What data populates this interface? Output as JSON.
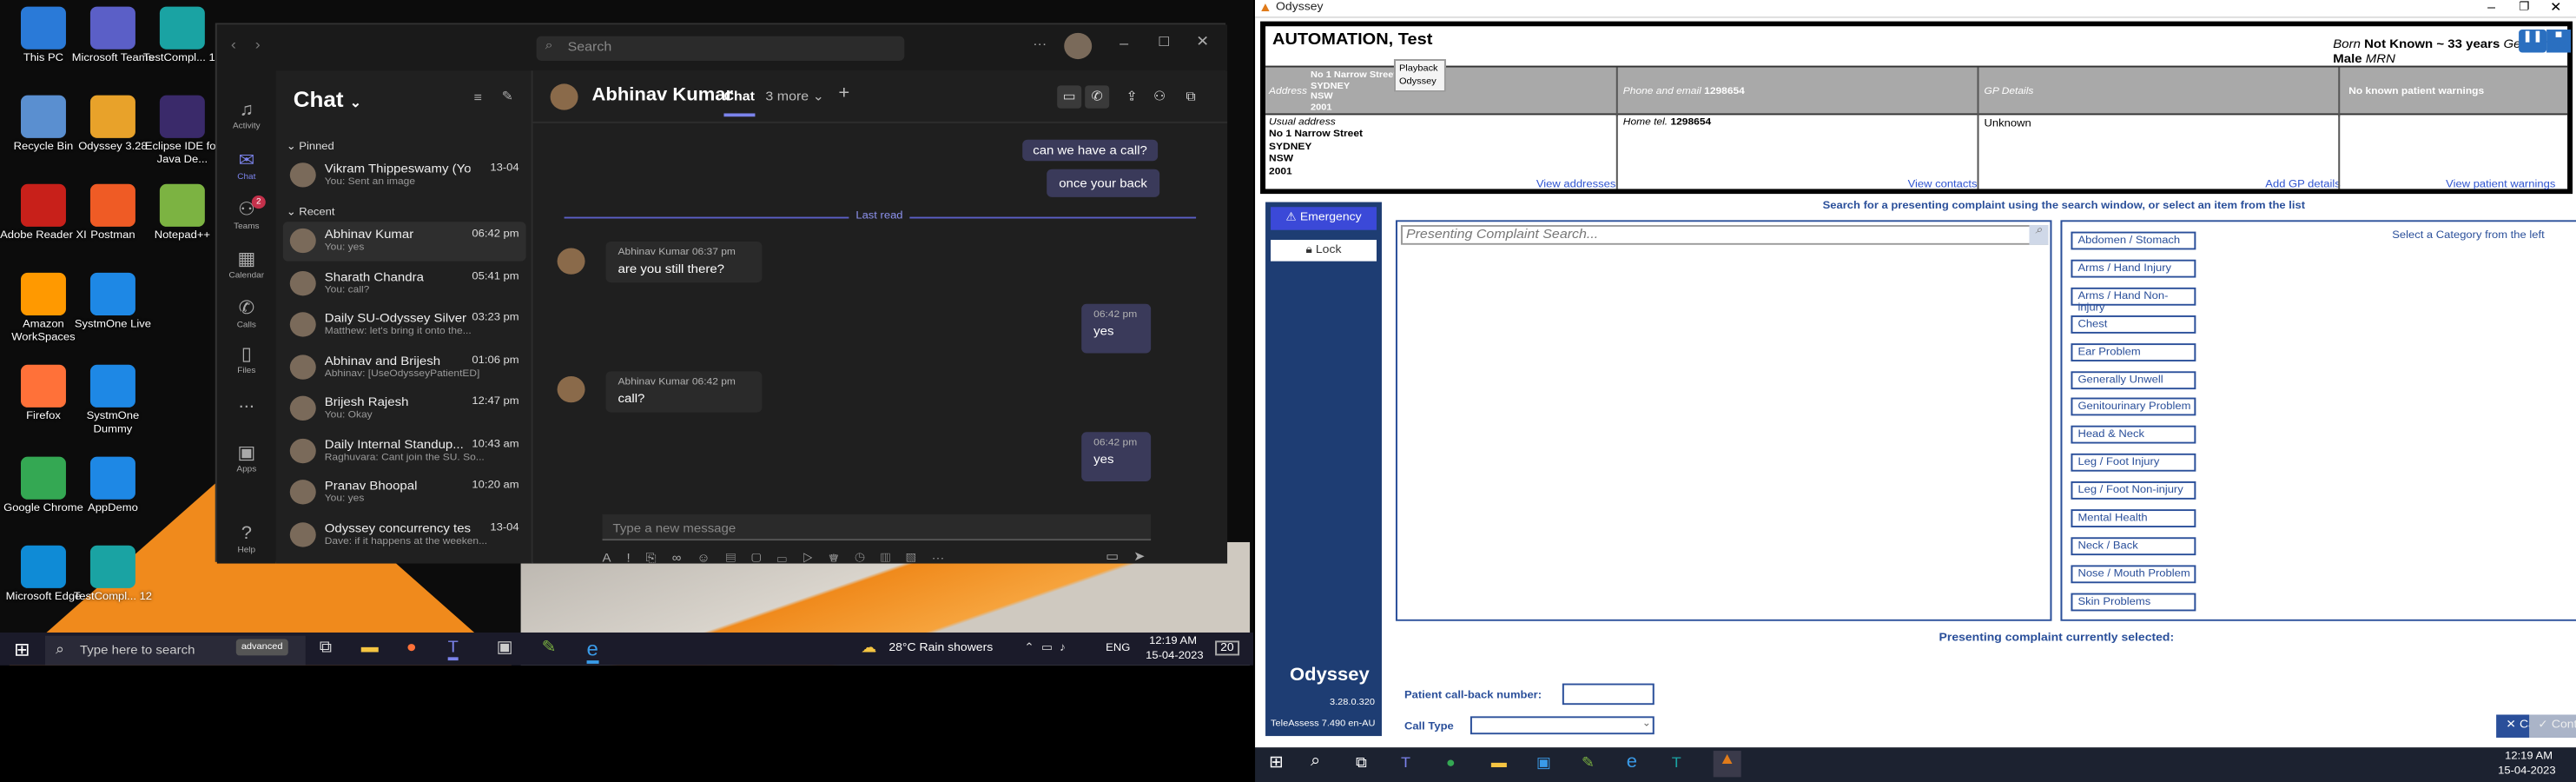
{
  "desktop": {
    "icons": [
      {
        "label": "This PC",
        "icon": "computer-icon",
        "color": "#2a7ad8"
      },
      {
        "label": "Microsoft Teams",
        "icon": "teams-icon",
        "color": "#5b5fc7"
      },
      {
        "label": "TestCompl... 14",
        "icon": "testcomplete-icon",
        "color": "#1aa3a3"
      },
      {
        "label": "Recycle Bin",
        "icon": "recycle-bin-icon",
        "color": "#5a8fd0"
      },
      {
        "label": "Odyssey 3.28",
        "icon": "odyssey-icon",
        "color": "#e8a22a"
      },
      {
        "label": "Eclipse IDE for Java De...",
        "icon": "eclipse-icon",
        "color": "#3a2a6a"
      },
      {
        "label": "Adobe Reader XI",
        "icon": "adobe-reader-icon",
        "color": "#c8201a"
      },
      {
        "label": "Postman",
        "icon": "postman-icon",
        "color": "#ef5b25"
      },
      {
        "label": "Notepad++",
        "icon": "notepad-plus-icon",
        "color": "#7cb342"
      },
      {
        "label": "Amazon WorkSpaces",
        "icon": "workspaces-icon",
        "color": "#ff9900"
      },
      {
        "label": "SystmOne Live",
        "icon": "systmone-icon",
        "color": "#1e88e5"
      },
      {
        "label": "Firefox",
        "icon": "firefox-icon",
        "color": "#ff7139"
      },
      {
        "label": "SystmOne Dummy",
        "icon": "systmone-icon",
        "color": "#1e88e5"
      },
      {
        "label": "Google Chrome",
        "icon": "chrome-icon",
        "color": "#34a853"
      },
      {
        "label": "AppDemo",
        "icon": "systmone-icon",
        "color": "#1e88e5"
      },
      {
        "label": "Microsoft Edge",
        "icon": "edge-icon",
        "color": "#0f8bd6"
      },
      {
        "label": "TestCompl... 12",
        "icon": "testcomplete-icon",
        "color": "#1aa3a3"
      }
    ]
  },
  "teams": {
    "search_placeholder": "Search",
    "rail": [
      "Activity",
      "Chat",
      "Teams",
      "Calendar",
      "Calls",
      "Files",
      "...",
      "Apps",
      "Help"
    ],
    "teams_badge": "2",
    "list_title": "Chat",
    "pinned_label": "Pinned",
    "recent_label": "Recent",
    "pinned": [
      {
        "name": "Vikram Thippeswamy (Yo...",
        "time": "13-04",
        "preview": "You: Sent an image"
      }
    ],
    "recent": [
      {
        "name": "Abhinav Kumar",
        "time": "06:42 pm",
        "preview": "You: yes",
        "selected": true
      },
      {
        "name": "Sharath Chandra",
        "time": "05:41 pm",
        "preview": "You: call?"
      },
      {
        "name": "Daily SU-Odyssey Silver",
        "time": "03:23 pm",
        "preview": "Matthew: let's bring it onto the..."
      },
      {
        "name": "Abhinav and Brijesh",
        "time": "01:06 pm",
        "preview": "Abhinav: [UseOdysseyPatientED]"
      },
      {
        "name": "Brijesh Rajesh",
        "time": "12:47 pm",
        "preview": "You: Okay"
      },
      {
        "name": "Daily Internal Standup...",
        "time": "10:43 am",
        "preview": "Raghuvara: Cant join the SU. So..."
      },
      {
        "name": "Pranav Bhoopal",
        "time": "10:20 am",
        "preview": "You: yes"
      },
      {
        "name": "Odyssey concurrency tes...",
        "time": "13-04",
        "preview": "Dave: if it happens at the weeken..."
      }
    ],
    "conversation": {
      "contact": "Abhinav Kumar",
      "tab_chat": "Chat",
      "tab_more": "3 more",
      "plus": "+",
      "msg_top1": "can we have a call?",
      "msg_top2": "once your back",
      "last_read": "Last read",
      "messages": [
        {
          "sender": "Abhinav Kumar",
          "time": "06:37 pm",
          "text": "are you still there?"
        },
        {
          "time": "06:42 pm",
          "text": "yes"
        },
        {
          "sender": "Abhinav Kumar",
          "time": "06:42 pm",
          "text": "call?"
        },
        {
          "time": "06:42 pm",
          "text": "yes"
        }
      ],
      "compose_placeholder": "Type a new message"
    }
  },
  "taskbar_left": {
    "search_placeholder": "Type here to search",
    "search_tag": "advanced",
    "weather": "28°C  Rain showers",
    "lang": "ENG",
    "time": "12:19 AM",
    "date": "15-04-2023",
    "badge": "20"
  },
  "odyssey": {
    "window_title": "Odyssey",
    "patient_name": "AUTOMATION, Test",
    "born_label": "Born",
    "born_value": "Not Known ~ 33 years",
    "gender_label": "Gender",
    "gender_value": "Male",
    "mrn_label": "MRN",
    "tooltip_l1": "Playback",
    "tooltip_l2": "Odyssey",
    "address_label": "Address",
    "address_lines": [
      "No 1 Narrow Street",
      "SYDNEY",
      "NSW",
      "2001"
    ],
    "phone_label": "Phone and email",
    "phone_value": "1298654",
    "gp_label": "GP Details",
    "warnings_label": "No known patient warnings",
    "usual_address_label": "Usual address",
    "home_tel_label": "Home tel.",
    "home_tel_value": "1298654",
    "gp_value": "Unknown",
    "view_addresses": "View addresses",
    "view_contacts": "View contacts",
    "add_gp": "Add GP details",
    "view_warnings": "View patient warnings",
    "emergency_label": "Emergency",
    "lock_label": "Lock",
    "instructions": "Search for a presenting complaint using the search window, or select an item from the list",
    "search_placeholder": "Presenting Complaint Search...",
    "category_hint": "Select a Category from the left",
    "categories": [
      "Abdomen / Stomach",
      "Arms / Hand Injury",
      "Arms / Hand Non-injury",
      "Chest",
      "Ear Problem",
      "Generally Unwell",
      "Genitourinary Problem",
      "Head & Neck",
      "Leg / Foot Injury",
      "Leg / Foot Non-injury",
      "Mental Health",
      "Neck / Back",
      "Nose / Mouth Problem",
      "Skin Problems"
    ],
    "selected_label": "Presenting complaint currently selected:",
    "brand": "Odyssey",
    "version": "3.28.0.320",
    "teleassess": "TeleAssess 7.490 en-AU",
    "callback_label": "Patient call-back number:",
    "calltype_label": "Call Type",
    "cancel_label": "Cancel & go back",
    "continue_label": "Continue"
  },
  "taskbar_right": {
    "time": "12:19 AM",
    "date": "15-04-2023"
  }
}
